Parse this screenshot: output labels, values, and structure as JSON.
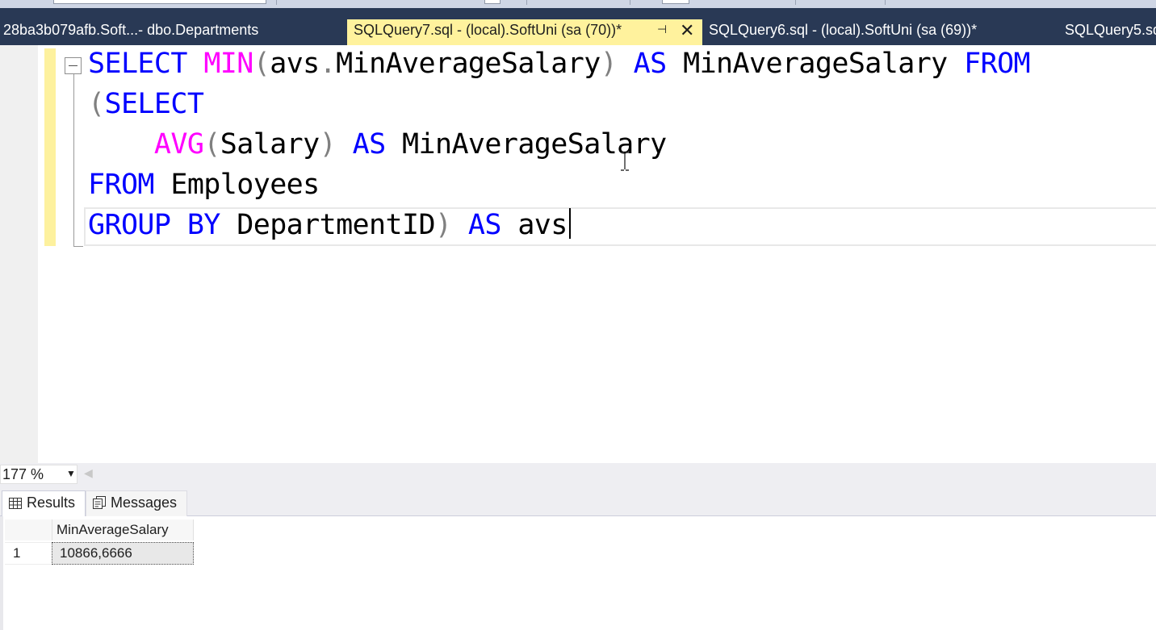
{
  "tabs": [
    {
      "label": "28ba3b079afb.Soft...- dbo.Departments",
      "active": false
    },
    {
      "label": "SQLQuery7.sql - (local).SoftUni (sa (70))*",
      "active": true
    },
    {
      "label": "SQLQuery6.sql - (local).SoftUni (sa (69))*",
      "active": false
    },
    {
      "label": "SQLQuery5.sq",
      "active": false
    }
  ],
  "editor": {
    "lines": [
      [
        {
          "t": "SELECT",
          "c": "kw"
        },
        {
          "t": " "
        },
        {
          "t": "MIN",
          "c": "fn"
        },
        {
          "t": "(",
          "c": "op"
        },
        {
          "t": "avs"
        },
        {
          "t": ".",
          "c": "op"
        },
        {
          "t": "MinAverageSalary"
        },
        {
          "t": ")",
          "c": "op"
        },
        {
          "t": " "
        },
        {
          "t": "AS",
          "c": "kw"
        },
        {
          "t": " MinAverageSalary "
        },
        {
          "t": "FROM",
          "c": "kw"
        }
      ],
      [
        {
          "t": "(",
          "c": "op"
        },
        {
          "t": "SELECT",
          "c": "kw"
        }
      ],
      [
        {
          "t": "    "
        },
        {
          "t": "AVG",
          "c": "fn"
        },
        {
          "t": "(",
          "c": "op"
        },
        {
          "t": "Salary"
        },
        {
          "t": ")",
          "c": "op"
        },
        {
          "t": " "
        },
        {
          "t": "AS",
          "c": "kw"
        },
        {
          "t": " MinAverageSalary"
        }
      ],
      [
        {
          "t": "FROM",
          "c": "kw"
        },
        {
          "t": " Employees"
        }
      ],
      [
        {
          "t": "GROUP BY",
          "c": "kw"
        },
        {
          "t": " DepartmentID"
        },
        {
          "t": ")",
          "c": "op"
        },
        {
          "t": " "
        },
        {
          "t": "AS",
          "c": "kw"
        },
        {
          "t": " avs"
        }
      ]
    ],
    "colors": {
      "keyword": "#0000ff",
      "function": "#ff00ff",
      "operator": "#808080",
      "text": "#000000"
    }
  },
  "zoom": {
    "value": "177 %"
  },
  "results_tabs": [
    {
      "label": "Results",
      "icon": "grid-icon",
      "active": true
    },
    {
      "label": "Messages",
      "icon": "messages-icon",
      "active": false
    }
  ],
  "results": {
    "columns": [
      "MinAverageSalary"
    ],
    "rows": [
      {
        "num": "1",
        "cells": [
          "10866,6666"
        ]
      }
    ]
  },
  "theme": {
    "tab_strip": "#293955",
    "active_tab": "#fff29d",
    "gutter": "#f0f0f0",
    "change_marker": "#fdf19e"
  }
}
